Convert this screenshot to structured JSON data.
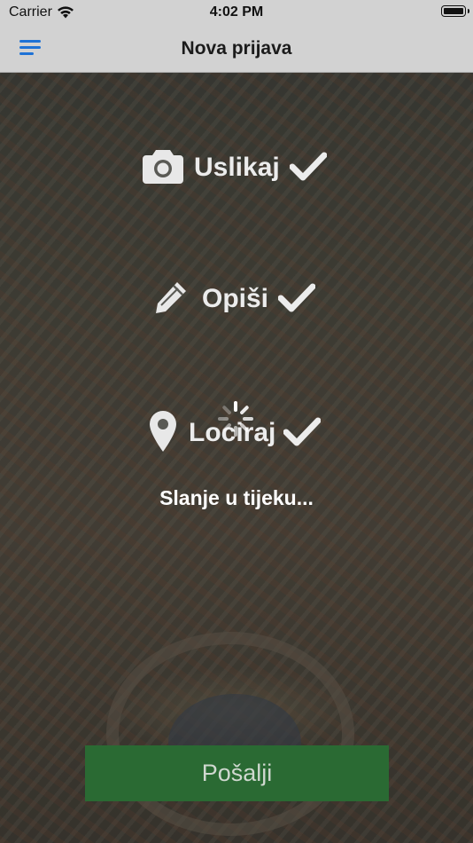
{
  "status_bar": {
    "carrier": "Carrier",
    "time": "4:02 PM",
    "wifi_icon": "wifi-icon",
    "battery_icon": "battery-icon"
  },
  "nav": {
    "title": "Nova prijava",
    "menu_icon": "menu-icon",
    "accent_color": "#1e72d6"
  },
  "steps": [
    {
      "label": "Uslikaj",
      "icon": "camera-icon",
      "completed": true
    },
    {
      "label": "Opiši",
      "icon": "pencil-icon",
      "completed": true
    },
    {
      "label": "Lociraj",
      "icon": "location-pin-icon",
      "completed": true
    }
  ],
  "progress": {
    "message": "Slanje u tijeku...",
    "spinner_icon": "spinner-icon"
  },
  "actions": {
    "send_label": "Pošalji",
    "send_color": "#2a6a33"
  }
}
